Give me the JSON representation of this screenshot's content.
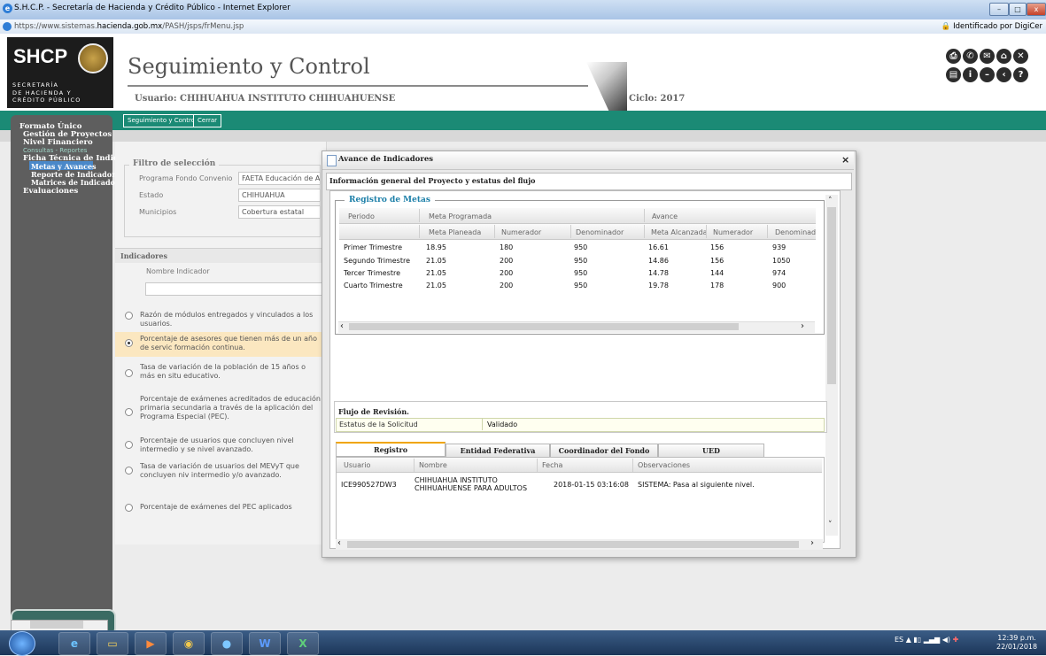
{
  "window": {
    "title": "S.H.C.P. - Secretaría de Hacienda y Crédito Público - Internet Explorer",
    "url_prefix": "https://www.sistemas.",
    "url_domain": "hacienda.gob.mx",
    "url_path": "/PASH/jsps/frMenu.jsp",
    "cert_label": "Identificado por DigiCer"
  },
  "logo": {
    "text": "SHCP",
    "sub1": "SECRETARÍA",
    "sub2": "DE HACIENDA Y",
    "sub3": "CRÉDITO PÚBLICO"
  },
  "header": {
    "title": "Seguimiento y Control",
    "usuario": "Usuario: CHIHUAHUA INSTITUTO CHIHUAHUENSE",
    "ciclo": "Ciclo: 2017"
  },
  "tabs": {
    "seguimiento": "Seguimiento y Control",
    "cerrar": "Cerrar"
  },
  "sidebar": {
    "formato": "Formato Único",
    "gestion": "Gestión de Proyectos",
    "nivel": "Nivel Financiero",
    "consultas": "Consultas - Reportes",
    "ficha": "Ficha Técnica de Indica",
    "metas": "Metas y Avances",
    "reporte": "Reporte de Indicador",
    "matrices": "Matrices de Indicador",
    "evaluaciones": "Evaluaciones"
  },
  "filtro": {
    "title": "Filtro de selección",
    "programa_label": "Programa Fondo Convenio",
    "programa_value": "FAETA Educación de A",
    "estado_label": "Estado",
    "estado_value": "CHIHUAHUA",
    "municipios_label": "Municipios",
    "municipios_value": "Cobertura estatal"
  },
  "indicadores": {
    "title": "Indicadores",
    "col": "Nombre Indicador",
    "items": [
      "Razón de módulos entregados y vinculados a los usuarios.",
      "Porcentaje de asesores que tienen más de un año de servic formación continua.",
      "Tasa de variación de la población de 15 años o más en situ educativo.",
      "Porcentaje de exámenes acreditados de educación primaria secundaria a través de la aplicación del Programa Especial (PEC).",
      "Porcentaje de usuarios que concluyen nivel intermedio y se nivel avanzado.",
      "Tasa de variación de usuarios del MEVyT que concluyen niv intermedio y/o avanzado.",
      "Porcentaje de exámenes del PEC aplicados"
    ]
  },
  "modal": {
    "title": "Avance de Indicadores",
    "close": "×",
    "info_title": "Información general del Proyecto y estatus del flujo",
    "metas_legend": "Registro de Metas",
    "group_headers": {
      "periodo": "Periodo",
      "meta": "Meta Programada",
      "avance": "Avance"
    },
    "columns": [
      "Meta Planeada",
      "Numerador",
      "Denominador",
      "Meta Alcanzada",
      "Numerador",
      "Denominado"
    ],
    "rows": [
      [
        "Primer Trimestre",
        "18.95",
        "180",
        "950",
        "16.61",
        "156",
        "939"
      ],
      [
        "Segundo Trimestre",
        "21.05",
        "200",
        "950",
        "14.86",
        "156",
        "1050"
      ],
      [
        "Tercer Trimestre",
        "21.05",
        "200",
        "950",
        "14.78",
        "144",
        "974"
      ],
      [
        "Cuarto Trimestre",
        "21.05",
        "200",
        "950",
        "19.78",
        "178",
        "900"
      ]
    ],
    "flujo_title": "Flujo de Revisión.",
    "estatus_label": "Estatus de la Solicitud",
    "estatus_value": "Validado",
    "rev_tabs": [
      "Registro",
      "Entidad Federativa",
      "Coordinador del Fondo",
      "UED"
    ],
    "rev_columns": [
      "Usuario",
      "Nombre",
      "Fecha",
      "Observaciones"
    ],
    "rev_row": {
      "usuario": "ICE990527DW3",
      "nombre1": "CHIHUAHUA INSTITUTO",
      "nombre2": "CHIHUAHUENSE PARA ADULTOS",
      "fecha": "2018-01-15 03:16:08",
      "obs": "SISTEMA: Pasa al siguiente nivel."
    }
  },
  "taskbar": {
    "lang": "ES",
    "time": "12:39 p.m.",
    "date": "22/01/2018"
  },
  "colors": {
    "teal": "#1b8a75",
    "legend": "#1c7fa8",
    "selected_row": "#fbe7c0"
  }
}
